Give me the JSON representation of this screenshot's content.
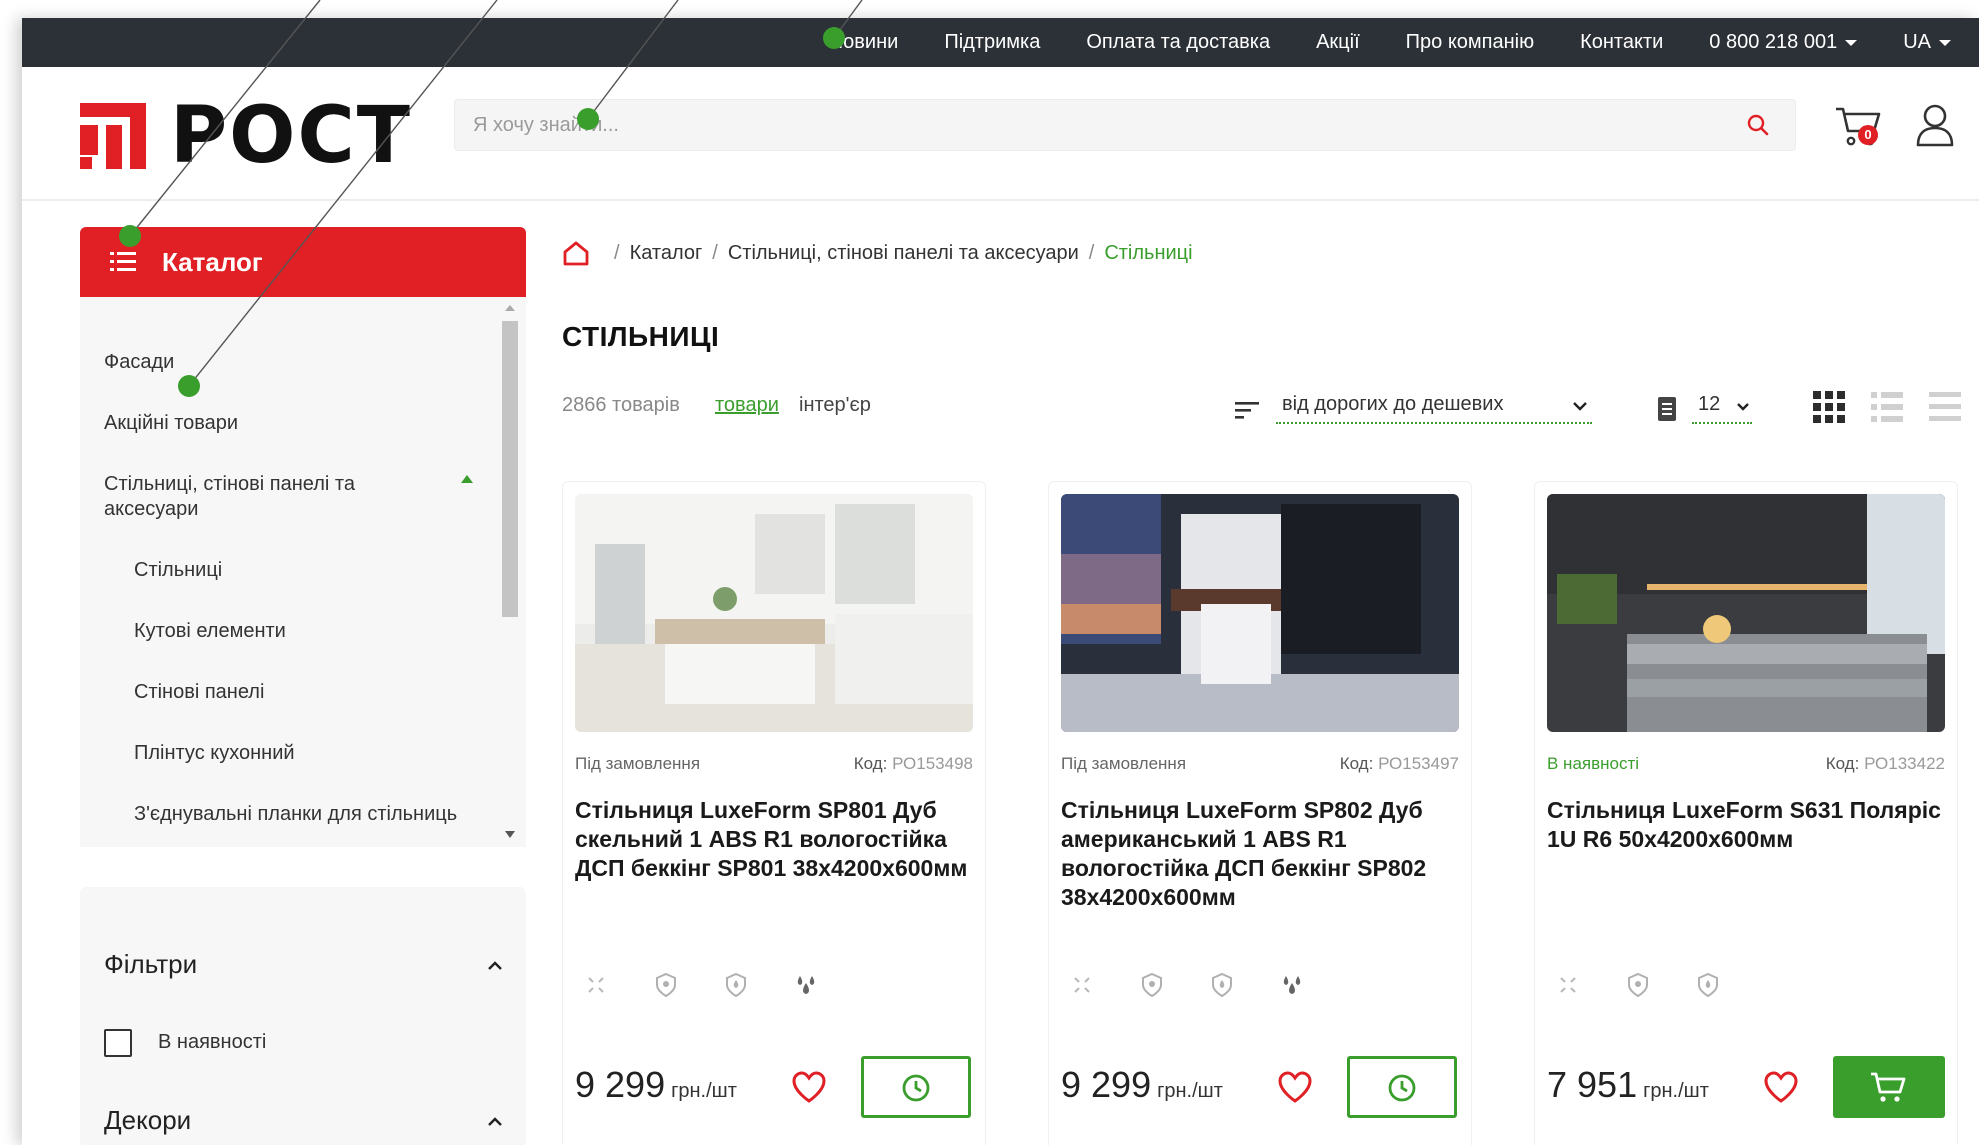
{
  "topnav": {
    "items": [
      "Новини",
      "Підтримка",
      "Оплата та доставка",
      "Акції",
      "Про компанію",
      "Контакти"
    ],
    "phone": "0 800 218 001",
    "lang": "UA"
  },
  "header": {
    "logo_text": "РОСТ",
    "search_placeholder": "Я хочу знайти...",
    "cart_count": "0"
  },
  "sidebar": {
    "catalog_label": "Каталог",
    "items": [
      "Фасади",
      "Акційні товари",
      "Стільниці, стінові панелі та аксесуари",
      "Стільниці",
      "Кутові елементи",
      "Стінові панелі",
      "Плінтус кухонний",
      "З'єднувальні планки для стільниць"
    ],
    "filters_title": "Фільтри",
    "filter_in_stock": "В наявності",
    "decors_title": "Декори"
  },
  "breadcrumb": {
    "items": [
      "Каталог",
      "Стільниці, стінові панелі та аксесуари"
    ],
    "current": "Стільниці"
  },
  "page_title": "СТІЛЬНИЦІ",
  "toolbar": {
    "count": "2866 товарів",
    "link_products": "товари",
    "link_interior": "інтер'єр",
    "sort_value": "від дорогих до дешевих",
    "per_page": "12"
  },
  "products": [
    {
      "status": "Під замовлення",
      "code_label": "Код:",
      "code": "РО153498",
      "title": "Стільниця LuxeForm SP801 Дуб скельний 1 ABS R1 вологостійка ДСП беккінг SP801 38х4200х600мм",
      "price": "9 299",
      "unit": "грн./шт",
      "action": "order"
    },
    {
      "status": "Під замовлення",
      "code_label": "Код:",
      "code": "РО153497",
      "title": "Стільниця LuxeForm SP802 Дуб американський 1 ABS R1 вологостійка ДСП беккінг SP802 38х4200х600мм",
      "price": "9 299",
      "unit": "грн./шт",
      "action": "order"
    },
    {
      "status": "В наявності",
      "code_label": "Код:",
      "code": "РО133422",
      "title": "Стільниця LuxeForm S631 Поляріс 1U R6 50х4200х600мм",
      "price": "7 951",
      "unit": "грн./шт",
      "action": "cart"
    }
  ],
  "colors": {
    "brand_red": "#e02025",
    "accent_green": "#3a9e2d",
    "topbar_bg": "#2c3138"
  }
}
